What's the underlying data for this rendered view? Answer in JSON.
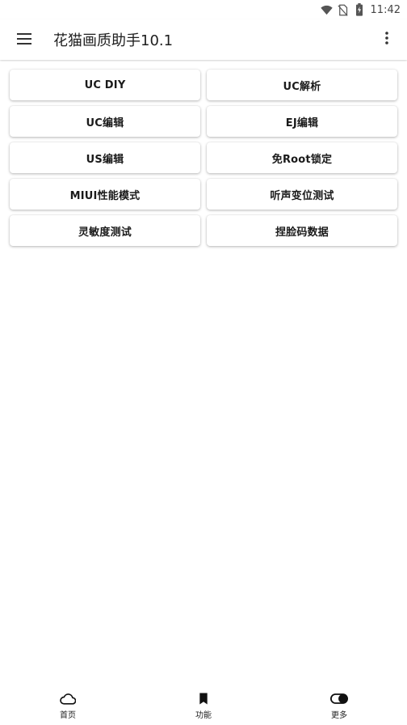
{
  "status_bar": {
    "time": "11:42",
    "icons": [
      "wifi-icon",
      "no-sim-icon",
      "battery-charging-icon"
    ]
  },
  "app_bar": {
    "title": "花猫画质助手10.1",
    "menu_icon": "hamburger-menu-icon",
    "overflow_icon": "more-vert-icon"
  },
  "buttons": [
    {
      "label": "UC DIY"
    },
    {
      "label": "UC解析"
    },
    {
      "label": "UC编辑"
    },
    {
      "label": "EJ编辑"
    },
    {
      "label": "US编辑"
    },
    {
      "label": "免Root锁定"
    },
    {
      "label": "MIUI性能模式"
    },
    {
      "label": "听声变位测试"
    },
    {
      "label": "灵敏度测试"
    },
    {
      "label": "捏脸码数据"
    }
  ],
  "bottom_nav": {
    "items": [
      {
        "label": "首页",
        "icon": "cloud-icon"
      },
      {
        "label": "功能",
        "icon": "bookmark-icon"
      },
      {
        "label": "更多",
        "icon": "toggle-icon"
      }
    ]
  }
}
